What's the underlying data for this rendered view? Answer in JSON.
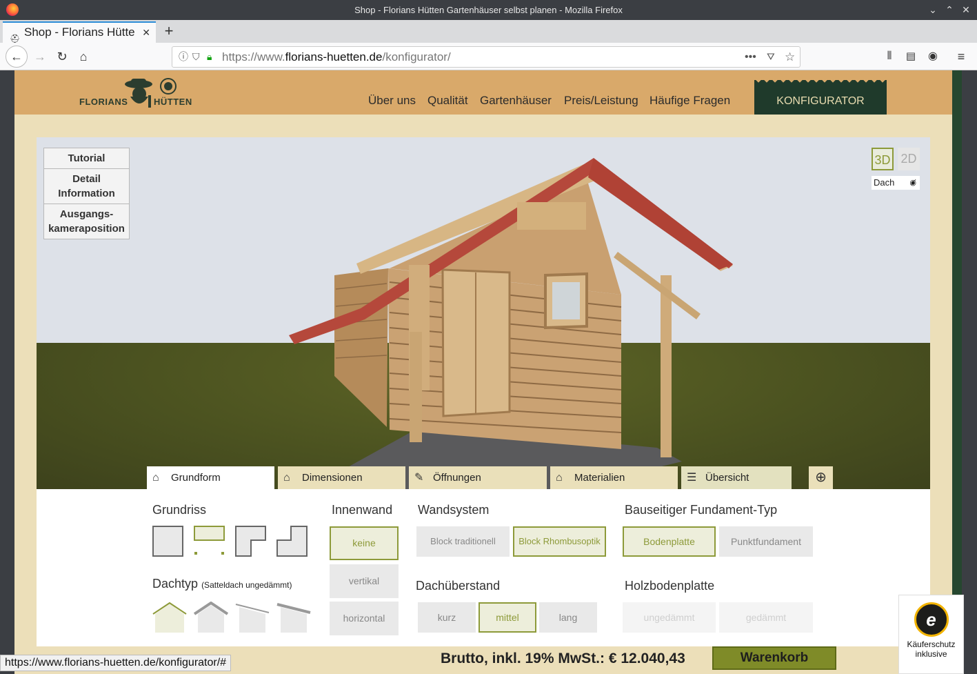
{
  "window": {
    "title": "Shop - Florians Hütten Gartenhäuser selbst planen - Mozilla Firefox"
  },
  "tab": {
    "label": "Shop - Florians Hütte"
  },
  "url": {
    "prefix": "https://www.",
    "domain": "florians-huetten.de",
    "path": "/konfigurator/"
  },
  "logo": {
    "left": "FLORIANS",
    "right": "HÜTTEN"
  },
  "nav": {
    "items": [
      "Über uns",
      "Qualität",
      "Gartenhäuser",
      "Preis/Leistung",
      "Häufige Fragen"
    ],
    "cta": "KONFIGURATOR"
  },
  "viewer": {
    "side_buttons": [
      "Tutorial",
      "Detail Information",
      "Ausgangs- kameraposition"
    ],
    "view_3d": "3D",
    "view_2d": "2D",
    "roof_toggle": "Dach"
  },
  "config_tabs": [
    "Grundform",
    "Dimensionen",
    "Öffnungen",
    "Materialien",
    "Übersicht"
  ],
  "config": {
    "grundriss": {
      "title": "Grundriss"
    },
    "dachtyp": {
      "title": "Dachtyp",
      "note": "(Satteldach ungedämmt)"
    },
    "innenwand": {
      "title": "Innenwand",
      "options": [
        "keine",
        "vertikal",
        "horizontal"
      ],
      "selected": "keine"
    },
    "wandsystem": {
      "title": "Wandsystem",
      "options": [
        "Block traditionell",
        "Block Rhombusoptik"
      ],
      "selected": "Block Rhombusoptik"
    },
    "dachueberstand": {
      "title": "Dachüberstand",
      "options": [
        "kurz",
        "mittel",
        "lang"
      ],
      "selected": "mittel"
    },
    "fundament": {
      "title": "Bauseitiger Fundament-Typ",
      "options": [
        "Bodenplatte",
        "Punktfundament"
      ],
      "selected": "Bodenplatte"
    },
    "holzbodenplatte": {
      "title": "Holzbodenplatte",
      "options": [
        "ungedämmt",
        "gedämmt"
      ]
    }
  },
  "price": {
    "label": "Brutto, inkl. 19% MwSt.: € 12.040,43"
  },
  "cart": {
    "label": "Warenkorb"
  },
  "trusted": {
    "line1": "Käuferschutz",
    "line2": "inklusive"
  },
  "status": {
    "url": "https://www.florians-huetten.de/konfigurator/#"
  },
  "colors": {
    "accent": "#8d9a39",
    "header": "#d9a96a",
    "dark_green": "#1f3a2b",
    "page_bg": "#ecdfb9"
  },
  "icons": [
    "firefox-icon",
    "reload-icon",
    "home-icon",
    "library-icon",
    "sidebar-icon",
    "account-icon",
    "menu-icon",
    "zoom-in-icon",
    "eye-slash-icon"
  ]
}
